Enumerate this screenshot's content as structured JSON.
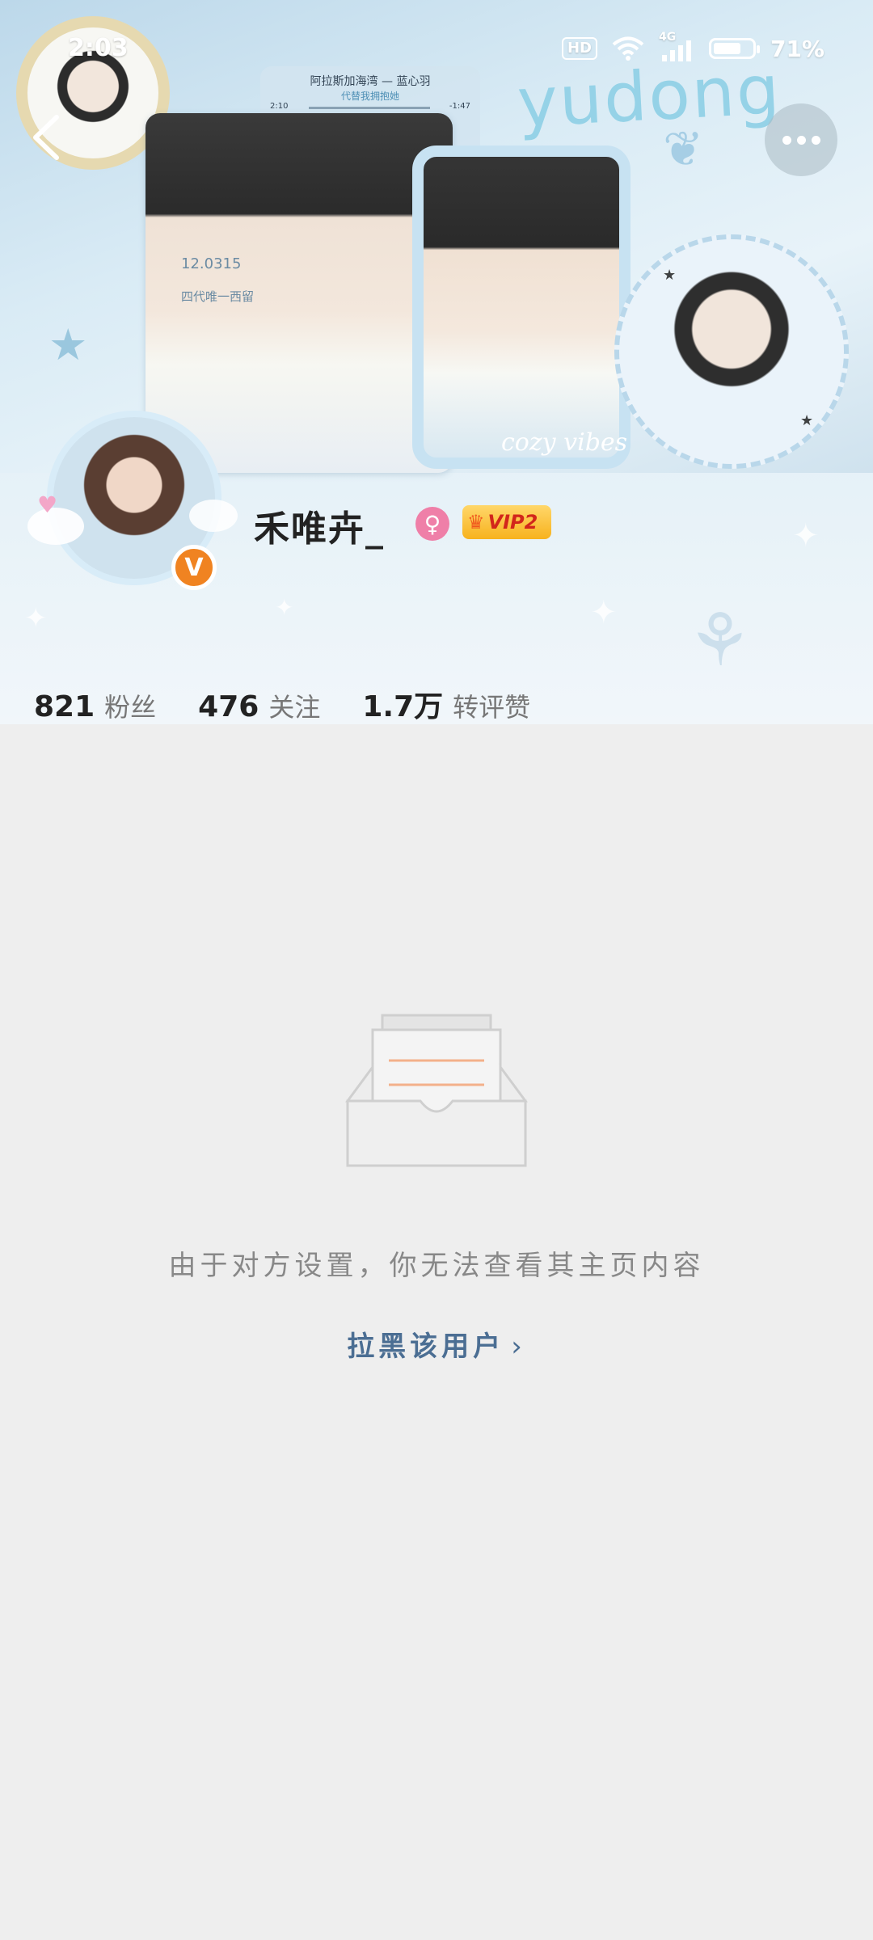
{
  "status_bar": {
    "time": "2:03",
    "hd_label": "HD",
    "network_label": "4G",
    "battery_percent": "71%",
    "battery_level": 0.71
  },
  "banner": {
    "wordmark": "yudong",
    "caption": "cozy vibes",
    "notebook_date": "12.0315",
    "notebook_text": "四代唯一西留",
    "music_song": "阿拉斯加海湾 — 蓝心羽",
    "music_sub": "代替我拥抱她",
    "music_elapsed": "2:10",
    "music_remaining": "-1:47"
  },
  "profile": {
    "username": "禾唯卉_",
    "gender_icon": "female-icon",
    "vip_label": "VIP2",
    "verified_label": "V"
  },
  "stats": [
    {
      "value": "821",
      "label": "粉丝"
    },
    {
      "value": "476",
      "label": "关注"
    },
    {
      "value": "1.7万",
      "label": "转评赞"
    }
  ],
  "empty_state": {
    "message": "由于对方设置，你无法查看其主页内容",
    "block_action": "拉黑该用户",
    "block_chevron": "›"
  },
  "colors": {
    "background": "#eeeeee",
    "link": "#4b6e93",
    "verified": "#f08321",
    "gender": "#ef7fa8"
  }
}
